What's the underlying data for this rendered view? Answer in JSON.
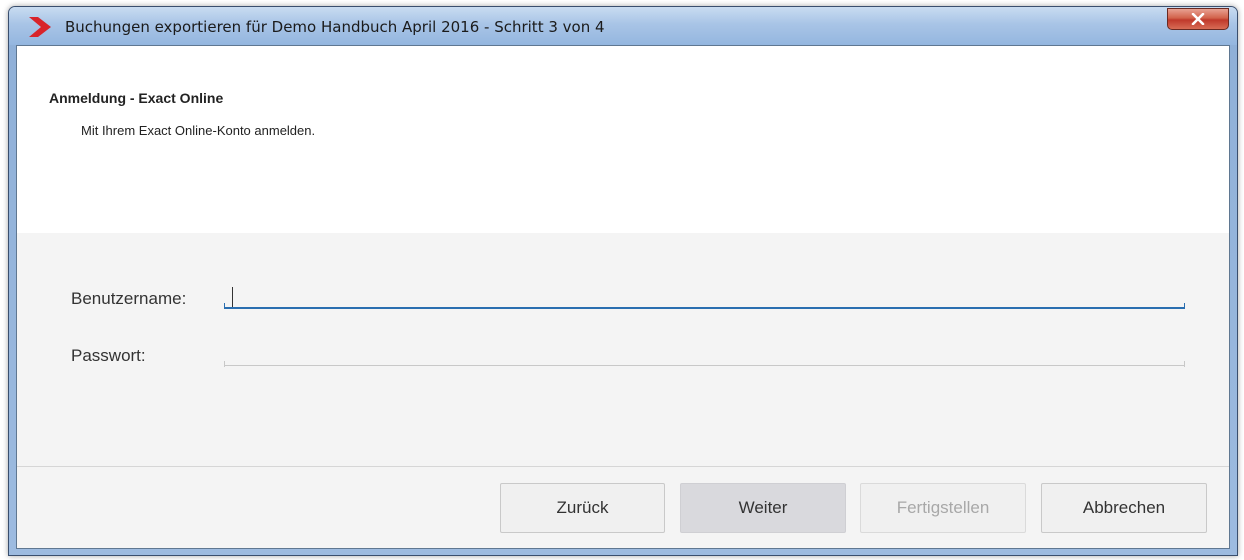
{
  "window": {
    "title": "Buchungen exportieren für Demo Handbuch April 2016 - Schritt 3 von 4",
    "logo_icon": "red-chevron-logo-icon",
    "close_icon": "close-x-icon",
    "close_color": "#c0392b"
  },
  "header": {
    "title": "Anmeldung - Exact Online",
    "subtitle": "Mit Ihrem Exact Online-Konto anmelden."
  },
  "form": {
    "username_label": "Benutzername:",
    "username_value": "",
    "password_label": "Passwort:",
    "password_value": "",
    "focus_color": "#2a6eb0"
  },
  "buttons": {
    "back": "Zurück",
    "next": "Weiter",
    "finish": "Fertigstellen",
    "cancel": "Abbrechen",
    "finish_disabled": true
  }
}
